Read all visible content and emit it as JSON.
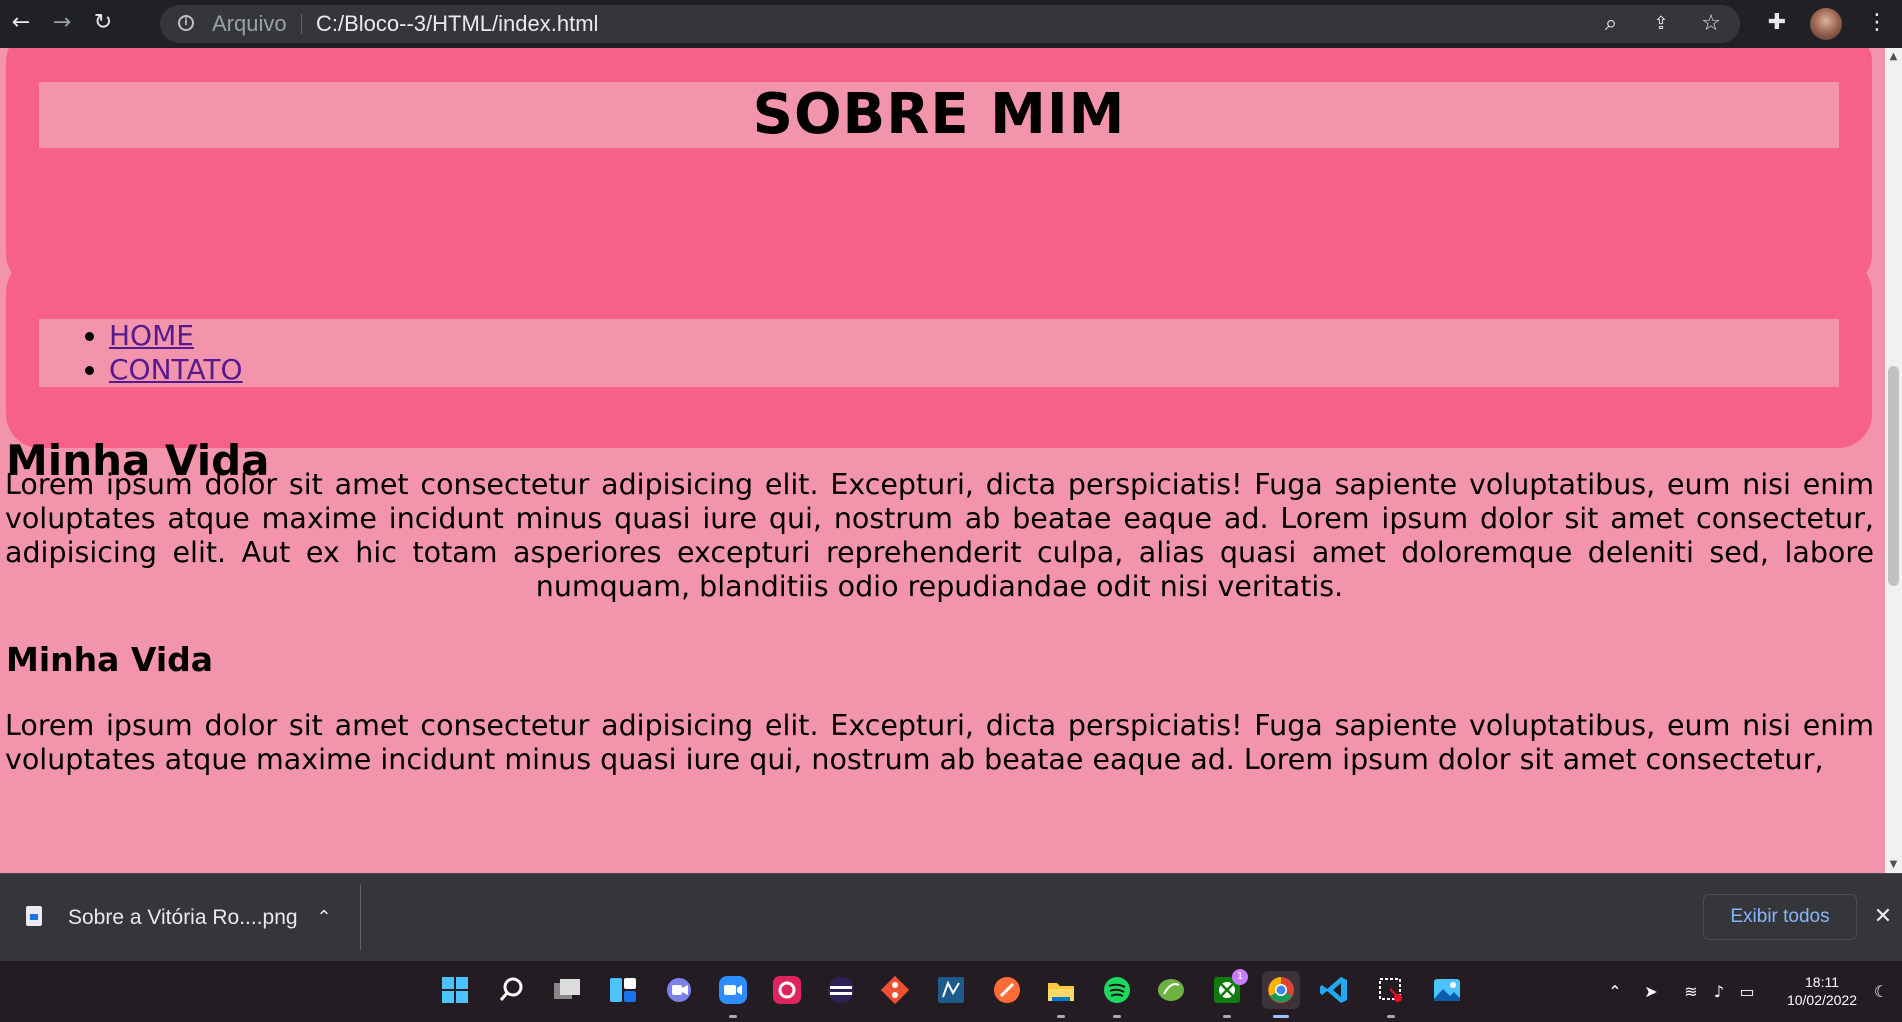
{
  "browser": {
    "scheme_label": "Arquivo",
    "url": "C:/Bloco--3/HTML/index.html",
    "icons": [
      "back-icon",
      "forward-icon",
      "reload-icon",
      "info-icon",
      "zoom-icon",
      "share-icon",
      "star-icon",
      "extensions-icon",
      "profile-avatar",
      "menu-icon"
    ]
  },
  "page": {
    "header_title": "SOBRE MIM",
    "nav": [
      "HOME",
      "CONTATO"
    ],
    "section1_heading": "Minha Vida",
    "section1_text": "Lorem ipsum dolor sit amet consectetur adipisicing elit. Excepturi, dicta perspiciatis! Fuga sapiente voluptatibus, eum nisi enim voluptates atque maxime incidunt minus quasi iure qui, nostrum ab beatae eaque ad. Lorem ipsum dolor sit amet consectetur, adipisicing elit. Aut ex hic totam asperiores excepturi reprehenderit culpa, alias quasi amet doloremque deleniti sed, labore numquam, blanditiis odio repudiandae odit nisi veritatis.",
    "section2_heading": "Minha Vida",
    "section2_text": "Lorem ipsum dolor sit amet consectetur adipisicing elit. Excepturi, dicta perspiciatis! Fuga sapiente voluptatibus, eum nisi enim voluptates atque maxime incidunt minus quasi iure qui, nostrum ab beatae eaque ad. Lorem ipsum dolor sit amet consectetur,",
    "colors": {
      "background": "#f394ad",
      "box": "#f76087",
      "link": "#551a8b"
    }
  },
  "downloads": {
    "file_name": "Sobre a Vitória Ro....png",
    "show_all_label": "Exibir todos"
  },
  "taskbar": {
    "apps": [
      "start-icon",
      "search-icon",
      "task-view-icon",
      "widgets-icon",
      "chat-icon",
      "zoom-icon",
      "creative-cloud-icon",
      "eclipse-icon",
      "git-icon",
      "mysql-workbench-icon",
      "postman-icon",
      "file-explorer-icon",
      "spotify-icon",
      "spring-tools-icon",
      "xbox-icon",
      "chrome-icon",
      "vscode-icon",
      "snipping-tool-icon",
      "photos-icon"
    ],
    "xbox_badge": "1",
    "time": "18:11",
    "date": "10/02/2022"
  }
}
